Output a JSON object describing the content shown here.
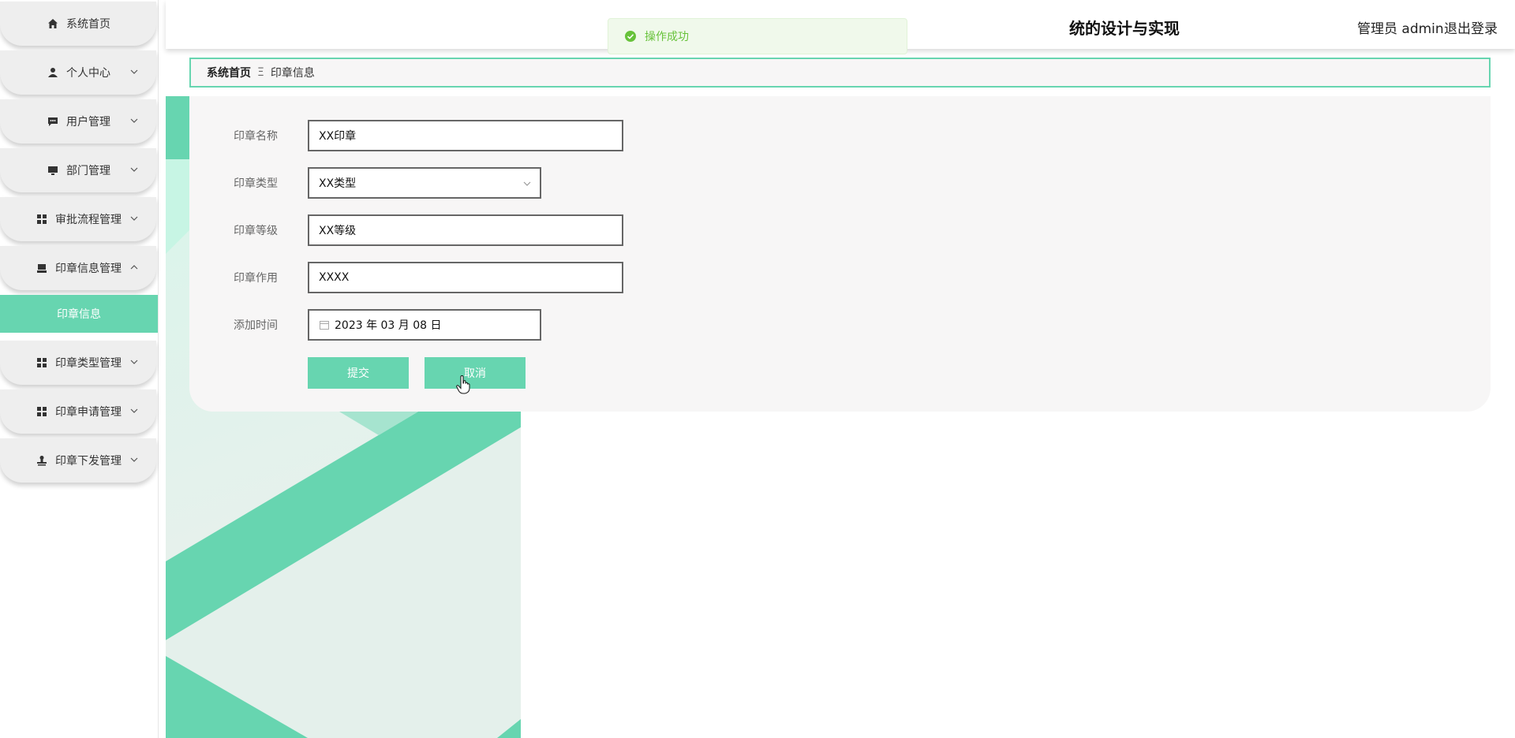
{
  "sidebar": {
    "items": [
      {
        "label": "系统首页",
        "icon": "home-icon"
      },
      {
        "label": "个人中心",
        "icon": "user-icon"
      },
      {
        "label": "用户管理",
        "icon": "chat-icon"
      },
      {
        "label": "部门管理",
        "icon": "monitor-icon"
      },
      {
        "label": "审批流程管理",
        "icon": "grid-icon"
      },
      {
        "label": "印章信息管理",
        "icon": "printer-icon"
      },
      {
        "label": "印章类型管理",
        "icon": "grid-icon"
      },
      {
        "label": "印章申请管理",
        "icon": "grid-icon"
      },
      {
        "label": "印章下发管理",
        "icon": "stamp-icon"
      }
    ],
    "active_sub": "印章信息"
  },
  "header": {
    "title": "统的设计与实现",
    "user": "管理员 admin",
    "logout": "退出登录"
  },
  "toast": {
    "message": "操作成功"
  },
  "breadcrumb": {
    "home": "系统首页",
    "separator": "Ξ",
    "current": "印章信息"
  },
  "form": {
    "name_label": "印章名称",
    "name_value": "XX印章",
    "type_label": "印章类型",
    "type_value": "XX类型",
    "level_label": "印章等级",
    "level_value": "XX等级",
    "usage_label": "印章作用",
    "usage_value": "XXXX",
    "time_label": "添加时间",
    "time_value": "2023 年 03 月 08 日",
    "submit": "提交",
    "cancel": "取消"
  },
  "colors": {
    "accent": "#67d5b0",
    "toast_text": "#67c23a",
    "toast_bg": "#f0f9eb"
  }
}
